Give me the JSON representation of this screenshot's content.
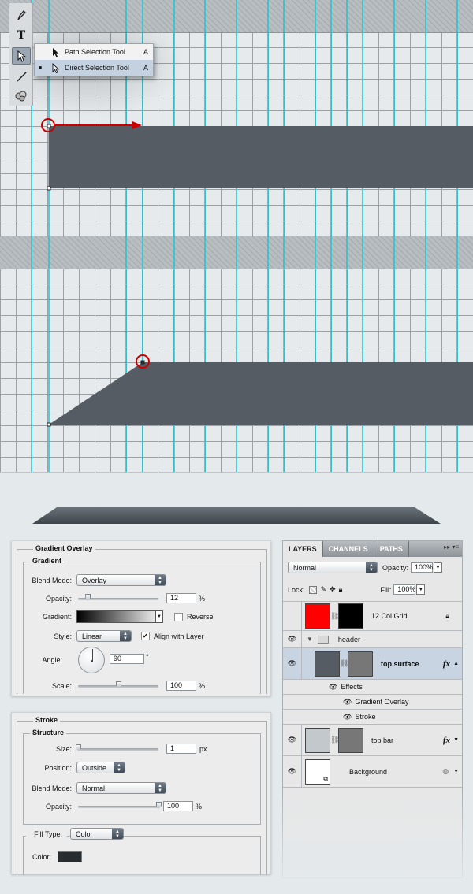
{
  "colors": {
    "guide": "#14c9d4",
    "shape": "#555c63",
    "marker": "#cc0000",
    "canvas": "#e6eaed",
    "stroke_color": "#252b2e"
  },
  "toolbar": {
    "tools": [
      {
        "name": "pen-icon",
        "glyph": "✒"
      },
      {
        "name": "type-icon",
        "glyph": "T"
      },
      {
        "name": "direct-selection-icon",
        "glyph": "↖"
      },
      {
        "name": "line-icon",
        "glyph": "╱"
      },
      {
        "name": "custom-shape-icon",
        "glyph": "❀"
      }
    ]
  },
  "flyout": {
    "items": [
      {
        "label": "Path Selection Tool",
        "shortcut": "A",
        "selected": false
      },
      {
        "label": "Direct Selection Tool",
        "shortcut": "A",
        "selected": true
      }
    ]
  },
  "gradient_overlay": {
    "title": "Gradient Overlay",
    "section": "Gradient",
    "blend_mode_label": "Blend Mode:",
    "blend_mode": "Overlay",
    "opacity_label": "Opacity:",
    "opacity": "12",
    "opacity_level": 0.12,
    "percent": "%",
    "gradient_label": "Gradient:",
    "reverse_label": "Reverse",
    "reverse_checked": false,
    "style_label": "Style:",
    "style": "Linear",
    "align_label": "Align with Layer",
    "align_checked": true,
    "angle_label": "Angle:",
    "angle": "90",
    "degree": "°",
    "scale_label": "Scale:",
    "scale": "100",
    "scale_level": 0.5
  },
  "stroke": {
    "title": "Stroke",
    "section": "Structure",
    "size_label": "Size:",
    "size": "1",
    "size_level": 0.0,
    "px": "px",
    "position_label": "Position:",
    "position": "Outside",
    "blend_mode_label": "Blend Mode:",
    "blend_mode": "Normal",
    "opacity_label": "Opacity:",
    "opacity": "100",
    "opacity_level": 1.0,
    "percent": "%",
    "fill_type_label": "Fill Type:",
    "fill_type": "Color",
    "color_label": "Color:"
  },
  "layers": {
    "tabs": [
      "LAYERS",
      "CHANNELS",
      "PATHS"
    ],
    "tab_menu": "▸▸ ▾≡",
    "blend_mode": "Normal",
    "opacity_label": "Opacity:",
    "opacity": "100%",
    "lock_label": "Lock:",
    "fill_label": "Fill:",
    "fill": "100%",
    "rows": {
      "grid": "12 Col Grid",
      "header": "header",
      "top_surface": "top surface",
      "effects": "Effects",
      "gradient_overlay": "Gradient Overlay",
      "stroke": "Stroke",
      "top_bar": "top bar",
      "background": "Background"
    },
    "fx": "fx"
  }
}
